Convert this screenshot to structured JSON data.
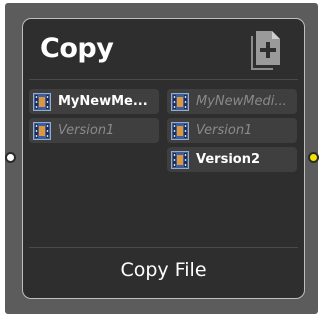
{
  "node": {
    "title": "Copy",
    "footer": "Copy File",
    "icon": "copy-file-icon"
  },
  "inputs": [
    {
      "label": "MyNewMe...",
      "state": "active"
    },
    {
      "label": "Version1",
      "state": "inactive"
    }
  ],
  "outputs": [
    {
      "label": "MyNewMedi...",
      "state": "inactive"
    },
    {
      "label": "Version1",
      "state": "inactive"
    },
    {
      "label": "Version2",
      "state": "active"
    }
  ],
  "ports": {
    "input_color": "#ffffff",
    "output_color": "#f2e400"
  },
  "colors": {
    "node_background": "#2e2e2e",
    "node_border": "#bfbfbf",
    "item_background": "#3f3f3f"
  }
}
